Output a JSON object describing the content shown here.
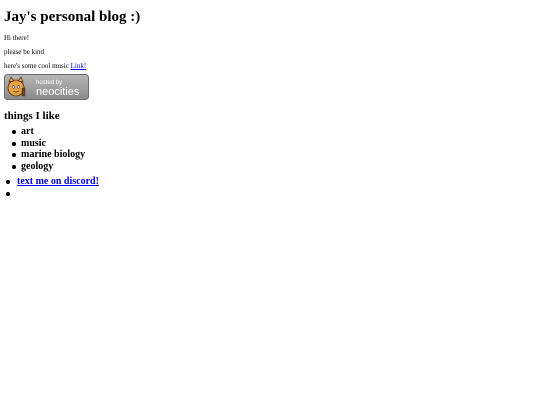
{
  "blog": {
    "title": "Jay's personal blog :)",
    "greeting": "Hi there!",
    "kind_note": "please be kind",
    "music_note": "here's some cool music ",
    "music_link": "Link!"
  },
  "badge": {
    "line1": "hosted by",
    "line2": "neocities"
  },
  "likes": {
    "heading": "things I like",
    "items": [
      "art",
      "music",
      "marine biology",
      "geology"
    ]
  },
  "contact": {
    "discord_link": "text me on discord!"
  }
}
